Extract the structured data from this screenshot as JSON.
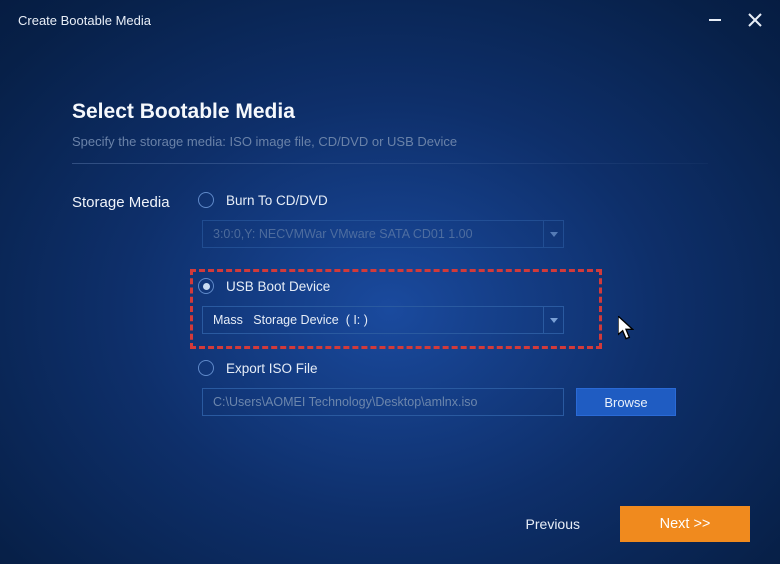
{
  "window": {
    "title": "Create Bootable Media"
  },
  "header": {
    "title": "Select Bootable Media",
    "subtitle": "Specify the storage media: ISO image file, CD/DVD or USB Device"
  },
  "form": {
    "label": "Storage Media"
  },
  "options": {
    "cd": {
      "label": "Burn To CD/DVD",
      "value": "3:0:0,Y: NECVMWar VMware SATA CD01 1.00",
      "selected": false
    },
    "usb": {
      "label": "USB Boot Device",
      "value": "Mass   Storage Device  ( I: )",
      "selected": true
    },
    "iso": {
      "label": "Export ISO File",
      "value": "C:\\Users\\AOMEI Technology\\Desktop\\amlnx.iso",
      "selected": false,
      "browse_label": "Browse"
    }
  },
  "footer": {
    "previous": "Previous",
    "next": "Next >>"
  }
}
